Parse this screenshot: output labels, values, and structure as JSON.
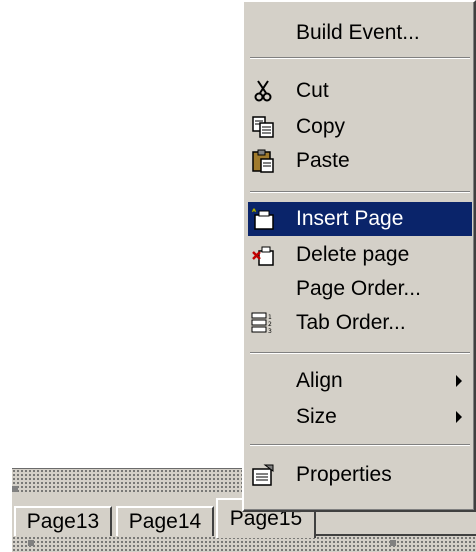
{
  "context_menu": {
    "items": [
      {
        "label": "Build Event...",
        "icon": "none"
      },
      {
        "label": "Cut",
        "icon": "scissors-icon"
      },
      {
        "label": "Copy",
        "icon": "copy-icon"
      },
      {
        "label": "Paste",
        "icon": "paste-icon"
      },
      {
        "label": "Insert Page",
        "icon": "insert-page-icon",
        "selected": true
      },
      {
        "label": "Delete page",
        "icon": "delete-page-icon"
      },
      {
        "label": "Page Order...",
        "icon": "none"
      },
      {
        "label": "Tab Order...",
        "icon": "tab-order-icon"
      },
      {
        "label": "Align",
        "icon": "none",
        "submenu": true
      },
      {
        "label": "Size",
        "icon": "none",
        "submenu": true
      },
      {
        "label": "Properties",
        "icon": "properties-icon"
      }
    ]
  },
  "tabs": [
    {
      "label": "Page13"
    },
    {
      "label": "Page14"
    },
    {
      "label": "Page15",
      "active": true
    }
  ],
  "colors": {
    "menu_face": "#d4d0c8",
    "selection": "#0a246a",
    "selection_text": "#ffffff"
  }
}
